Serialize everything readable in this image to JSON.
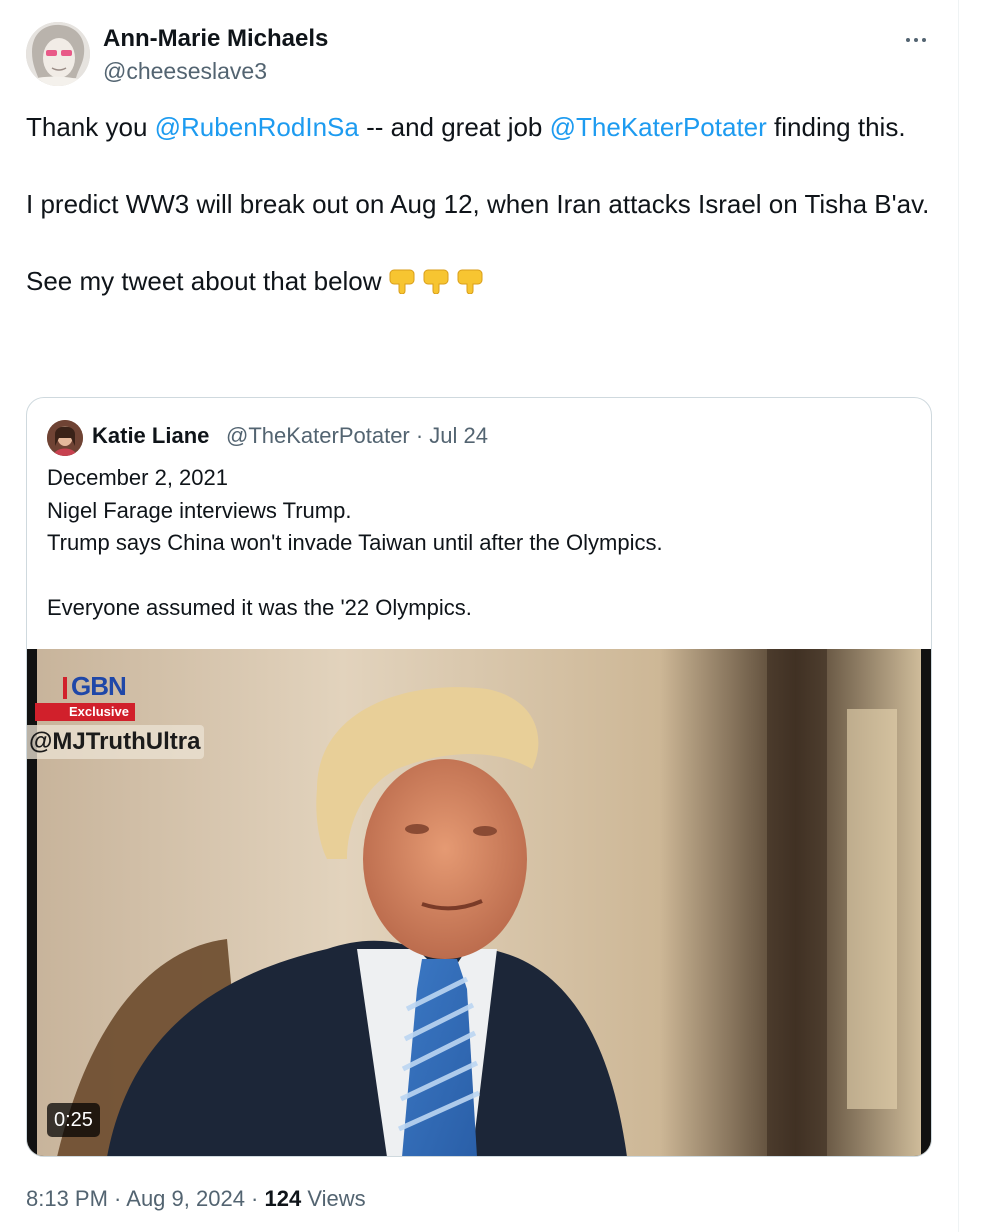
{
  "author": {
    "name": "Ann-Marie Michaels",
    "handle": "@cheeseslave3"
  },
  "tweet": {
    "line1_pre": "Thank you ",
    "mention1": "@RubenRodInSa",
    "line1_mid": " -- and great job ",
    "mention2": "@TheKaterPotater",
    "line1_post": " finding this.",
    "para2": "I predict WW3 will break out on Aug 12, when Iran attacks Israel on Tisha B'av.",
    "para3": "See my tweet about that below",
    "emoji": "backhand-index-pointing-down x3"
  },
  "quoted": {
    "name": "Katie Liane",
    "handle_line": "@TheKaterPotater · Jul 24",
    "lines": [
      "December 2, 2021",
      "Nigel Farage interviews Trump.",
      "Trump says China won't invade Taiwan until after the Olympics."
    ],
    "para2": "Everyone assumed it was the '22 Olympics.",
    "video": {
      "logo": "GBN",
      "badge": "Exclusive",
      "watermark": "@MJTruthUltra",
      "duration": "0:25"
    }
  },
  "meta": {
    "time_date": "8:13 PM · Aug 9, 2024 · ",
    "views_count": "124",
    "views_label": " Views"
  },
  "colors": {
    "link": "#1d9bf0",
    "secondary": "#536471",
    "border": "#cfd9de",
    "text": "#0f1419"
  },
  "icons": {
    "more": "more-horizontal-icon"
  }
}
